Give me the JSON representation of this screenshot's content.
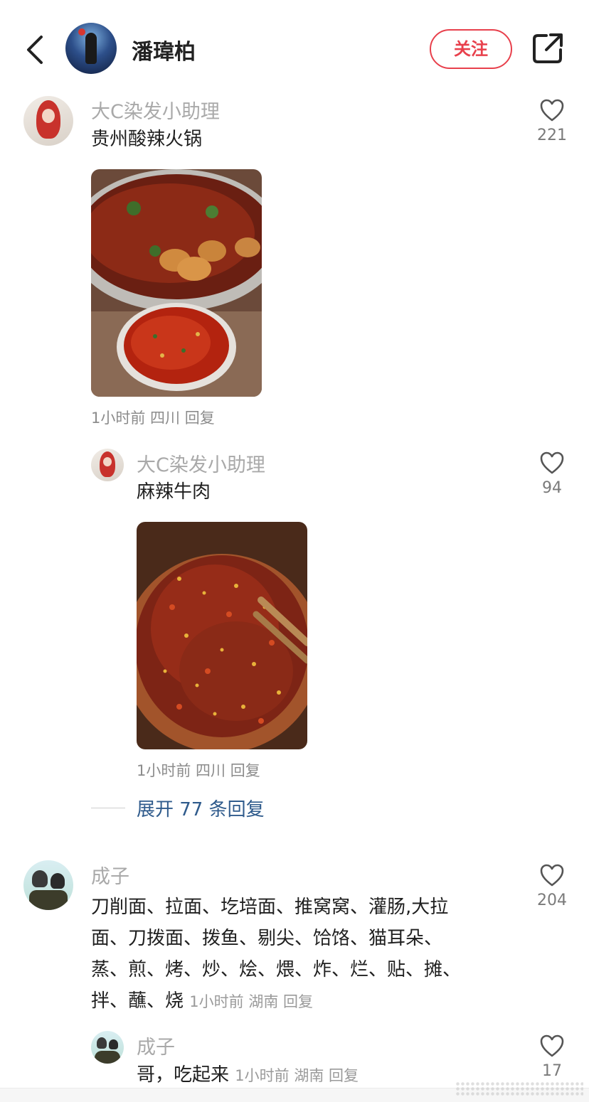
{
  "header": {
    "user_name": "潘瑋柏",
    "follow_label": "关注"
  },
  "comments": [
    {
      "author": "大C染发小助理",
      "text": "贵州酸辣火锅",
      "likes": "221",
      "meta": "1小时前 四川 回复",
      "replies": [
        {
          "author": "大C染发小助理",
          "text": "麻辣牛肉",
          "likes": "94",
          "meta": "1小时前 四川 回复"
        }
      ],
      "expand_label": "展开 77 条回复"
    },
    {
      "author": "成子",
      "text_lines": [
        "刀削面、拉面、圪培面、推窝窝、灌肠,大拉",
        "面、刀拨面、拨鱼、剔尖、饸饹、猫耳朵、",
        "蒸、煎、烤、炒、烩、煨、炸、烂、贴、摊、",
        "拌、蘸、烧"
      ],
      "likes": "204",
      "meta": "1小时前 湖南 回复",
      "replies": [
        {
          "author": "成子",
          "text": "哥，吃起来",
          "likes": "17",
          "meta": "1小时前 湖南 回复"
        }
      ]
    }
  ],
  "colors": {
    "accent": "#e8404c",
    "link": "#2f5b8c"
  },
  "icons": [
    "back-arrow-icon",
    "share-icon",
    "heart-icon"
  ]
}
